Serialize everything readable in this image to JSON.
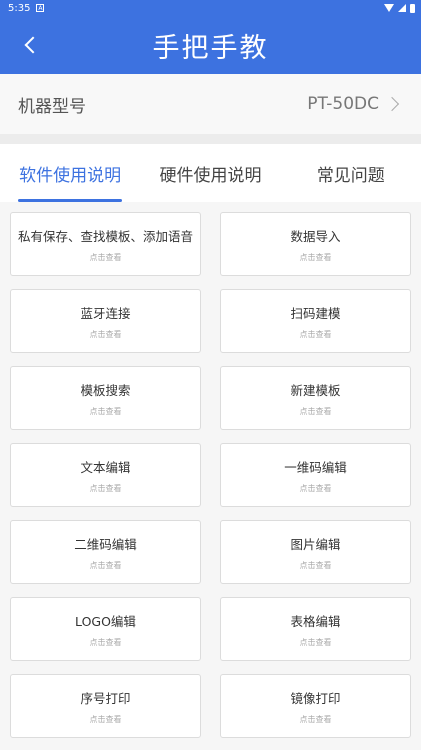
{
  "status_bar": {
    "time": "5:35",
    "note_icon": "A"
  },
  "header": {
    "title": "手把手教"
  },
  "model_row": {
    "label": "机器型号",
    "value": "PT-50DC"
  },
  "tabs": [
    {
      "label": "软件使用说明",
      "active": true
    },
    {
      "label": "硬件使用说明",
      "active": false
    },
    {
      "label": "常见问题",
      "active": false
    }
  ],
  "cards": [
    {
      "title": "私有保存、查找模板、添加语音",
      "subtitle": "点击查看"
    },
    {
      "title": "数据导入",
      "subtitle": "点击查看"
    },
    {
      "title": "蓝牙连接",
      "subtitle": "点击查看"
    },
    {
      "title": "扫码建模",
      "subtitle": "点击查看"
    },
    {
      "title": "模板搜索",
      "subtitle": "点击查看"
    },
    {
      "title": "新建模板",
      "subtitle": "点击查看"
    },
    {
      "title": "文本编辑",
      "subtitle": "点击查看"
    },
    {
      "title": "一维码编辑",
      "subtitle": "点击查看"
    },
    {
      "title": "二维码编辑",
      "subtitle": "点击查看"
    },
    {
      "title": "图片编辑",
      "subtitle": "点击查看"
    },
    {
      "title": "LOGO编辑",
      "subtitle": "点击查看"
    },
    {
      "title": "表格编辑",
      "subtitle": "点击查看"
    },
    {
      "title": "序号打印",
      "subtitle": "点击查看"
    },
    {
      "title": "镜像打印",
      "subtitle": "点击查看"
    }
  ],
  "colors": {
    "primary": "#3d72e0",
    "background": "#f3f3f3"
  }
}
